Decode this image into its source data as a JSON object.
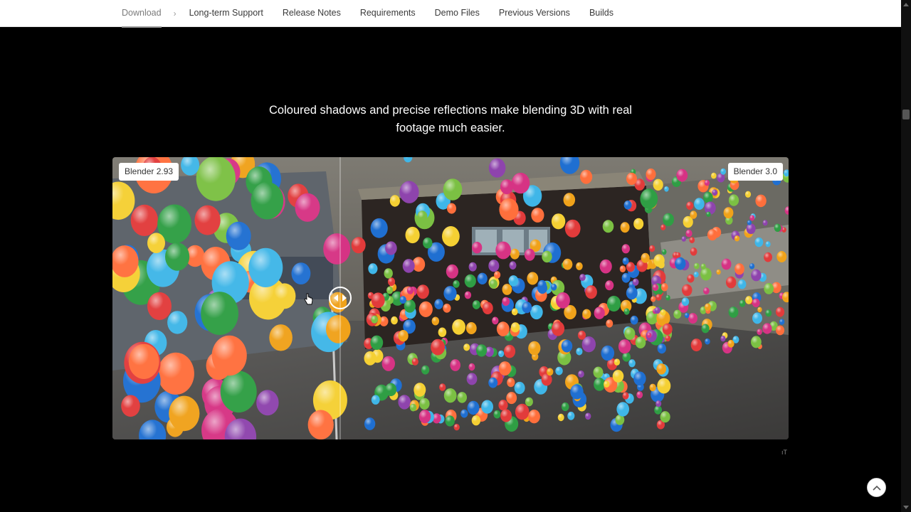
{
  "nav": {
    "active": "Download",
    "links": [
      "Long-term Support",
      "Release Notes",
      "Requirements",
      "Demo Files",
      "Previous Versions",
      "Builds"
    ]
  },
  "caption": "Coloured shadows and precise reflections make blending 3D with real footage much easier.",
  "compare": {
    "left_label": "Blender 2.93",
    "right_label": "Blender 3.0",
    "divider_position": 0.337
  },
  "footer_glyph": "ıT",
  "icons": {
    "breadcrumb": "chevron-right-icon",
    "back_to_top": "chevron-up-icon",
    "slider": "drag-handle-icon",
    "cursor": "hand-cursor-icon"
  }
}
